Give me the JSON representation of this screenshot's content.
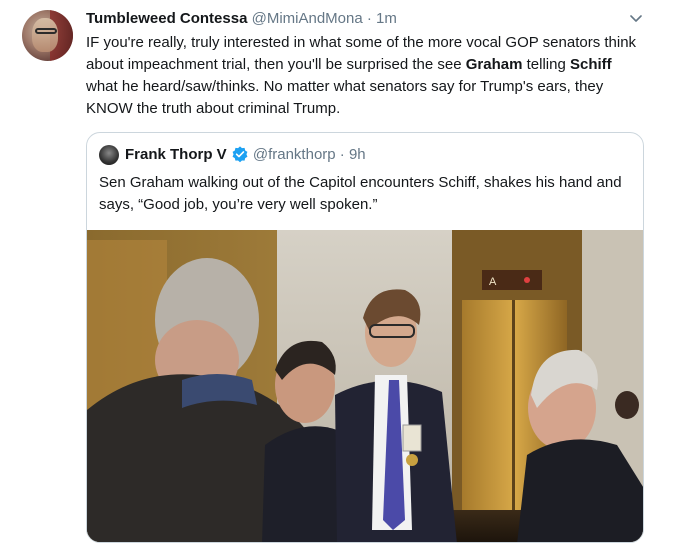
{
  "tweet": {
    "display_name": "Tumbleweed Contessa",
    "handle": "@MimiAndMona",
    "separator": "·",
    "time": "1m",
    "text_parts": {
      "part1": "IF you're really, truly interested in what some of the more vocal GOP senators think about impeachment trial, then you'll be surprised the see ",
      "bold1": "Graham",
      "part2": " telling ",
      "bold2": "Schiff",
      "part3": " what he heard/saw/thinks. No matter what senators say for Trump's ears, they KNOW the truth about criminal Trump."
    }
  },
  "quoted": {
    "display_name": "Frank Thorp V",
    "handle": "@frankthorp",
    "separator": "·",
    "time": "9h",
    "text": "Sen Graham walking out of the Capitol encounters Schiff, shakes his hand and says, “Good job, you’re very well spoken.”",
    "elevator_sign": "A"
  },
  "colors": {
    "text": "#14171a",
    "secondary": "#657786",
    "border": "#ccd6dd",
    "verified": "#1da1f2"
  },
  "icons": [
    "chevron-down-icon",
    "verified-badge-icon"
  ]
}
